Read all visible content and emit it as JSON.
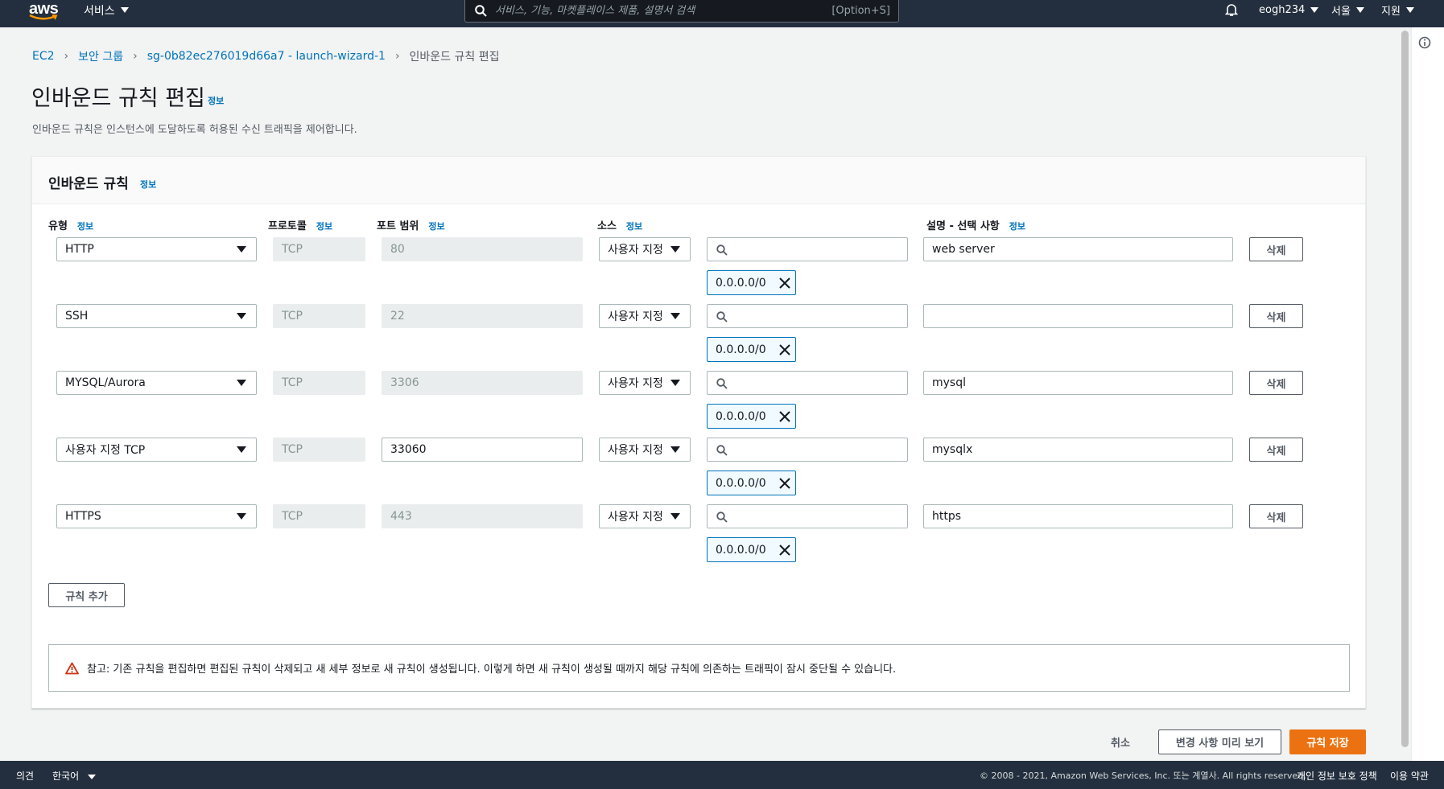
{
  "topnav": {
    "logo_text": "aws",
    "services_label": "서비스",
    "search_placeholder": "서비스, 기능, 마켓플레이스 제품, 설명서 검색",
    "search_shortcut": "[Option+S]",
    "account": "eogh234",
    "region": "서울",
    "support": "지원"
  },
  "breadcrumb": {
    "items": [
      "EC2",
      "보안 그룹",
      "sg-0b82ec276019d66a7 - launch-wizard-1"
    ],
    "current": "인바운드 규칙 편집"
  },
  "page": {
    "title": "인바운드 규칙 편집",
    "info": "정보",
    "description": "인바운드 규칙은 인스턴스에 도달하도록 허용된 수신 트래픽을 제어합니다."
  },
  "panel": {
    "title": "인바운드 규칙",
    "info": "정보",
    "columns": {
      "type": "유형",
      "protocol": "프로토콜",
      "port_range": "포트 범위",
      "source": "소스",
      "description": "설명 - 선택 사항",
      "info": "정보"
    },
    "rules": [
      {
        "type": "HTTP",
        "protocol": "TCP",
        "port": "80",
        "port_editable": false,
        "source_type": "사용자 지정",
        "cidr": "0.0.0.0/0",
        "description": "web server",
        "delete": "삭제"
      },
      {
        "type": "SSH",
        "protocol": "TCP",
        "port": "22",
        "port_editable": false,
        "source_type": "사용자 지정",
        "cidr": "0.0.0.0/0",
        "description": "",
        "delete": "삭제"
      },
      {
        "type": "MYSQL/Aurora",
        "protocol": "TCP",
        "port": "3306",
        "port_editable": false,
        "source_type": "사용자 지정",
        "cidr": "0.0.0.0/0",
        "description": "mysql",
        "delete": "삭제"
      },
      {
        "type": "사용자 지정 TCP",
        "protocol": "TCP",
        "port": "33060",
        "port_editable": true,
        "source_type": "사용자 지정",
        "cidr": "0.0.0.0/0",
        "description": "mysqlx",
        "delete": "삭제"
      },
      {
        "type": "HTTPS",
        "protocol": "TCP",
        "port": "443",
        "port_editable": false,
        "source_type": "사용자 지정",
        "cidr": "0.0.0.0/0",
        "description": "https",
        "delete": "삭제"
      }
    ],
    "add_rule": "규칙 추가",
    "alert": "참고: 기존 규칙을 편집하면 편집된 규칙이 삭제되고 새 세부 정보로 새 규칙이 생성됩니다. 이렇게 하면 새 규칙이 생성될 때까지 해당 규칙에 의존하는 트래픽이 잠시 중단될 수 있습니다."
  },
  "actions": {
    "cancel": "취소",
    "preview": "변경 사항 미리 보기",
    "save": "규칙 저장"
  },
  "footer": {
    "feedback": "의견",
    "language": "한국어",
    "copyright": "© 2008 - 2021, Amazon Web Services, Inc. 또는 계열사. All rights reserved.",
    "privacy": "개인 정보 보호 정책",
    "terms": "이용 약관"
  },
  "colors": {
    "nav_bg": "#232f3e",
    "link": "#0073bb",
    "primary": "#ec7211",
    "token_border": "#0073bb"
  }
}
